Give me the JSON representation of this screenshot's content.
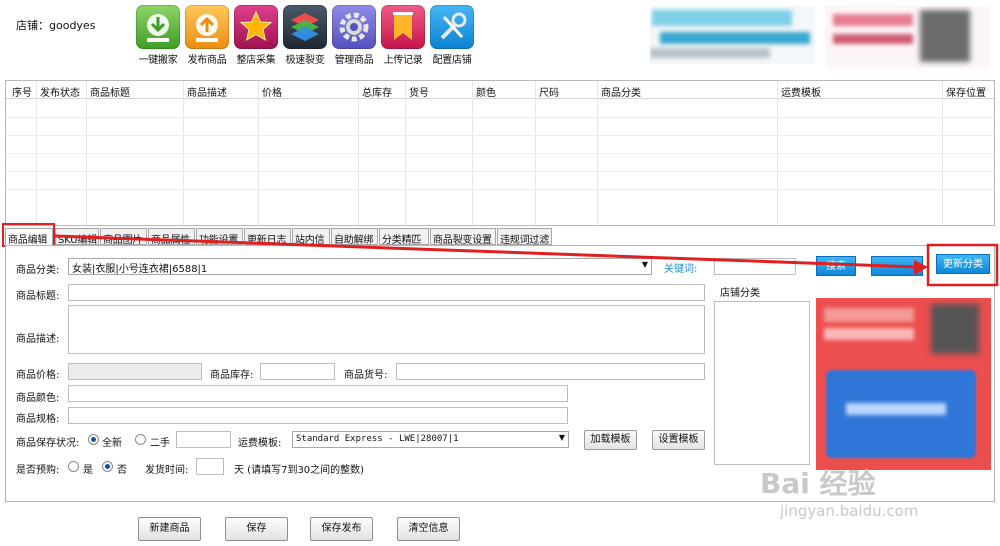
{
  "store": {
    "label": "店铺：goodyes"
  },
  "toolbar": [
    {
      "label": "一键搬家",
      "icon": "download-arrow-icon",
      "color": "#5cb83a"
    },
    {
      "label": "发布商品",
      "icon": "upload-arrow-icon",
      "color": "#f2a21a"
    },
    {
      "label": "整店采集",
      "icon": "star-icon",
      "color": "#c2186b"
    },
    {
      "label": "极速裂变",
      "icon": "layers-icon",
      "color": "#2f3a46"
    },
    {
      "label": "管理商品",
      "icon": "gear-icon",
      "color": "#6e6ad8"
    },
    {
      "label": "上传记录",
      "icon": "bookmark-icon",
      "color": "#e02c62"
    },
    {
      "label": "配置店铺",
      "icon": "tools-icon",
      "color": "#1196e3"
    }
  ],
  "grid": {
    "columns": [
      "序号",
      "发布状态",
      "商品标题",
      "商品描述",
      "价格",
      "总库存",
      "货号",
      "颜色",
      "尺码",
      "商品分类",
      "运费模板",
      "保存位置"
    ]
  },
  "tabs": [
    "商品编辑",
    "SKU编辑",
    "商品图片",
    "商品属性",
    "功能设置",
    "更新日志",
    "站内信",
    "自助解绑",
    "分类精匹",
    "商品裂变设置",
    "违规词过滤"
  ],
  "form": {
    "category_label": "商品分类:",
    "category_value": "女装|衣服|小号连衣裙|6588|1",
    "keyword_label": "关键词:",
    "search_btn": "搜索",
    "update_category_btn": "更新分类",
    "store_category_label": "店铺分类",
    "title_label": "商品标题:",
    "desc_label": "商品描述:",
    "price_label": "商品价格:",
    "stock_label": "商品库存:",
    "code_label": "商品货号:",
    "color_label": "商品颜色:",
    "spec_label": "商品规格:",
    "condition_label": "商品保存状况:",
    "condition_new": "全新",
    "condition_used": "二手",
    "shipping_label": "运费模板:",
    "shipping_value": "Standard Express - LWE|28007|1",
    "load_template_btn": "加载模板",
    "set_template_btn": "设置模板",
    "presale_label": "是否预购:",
    "presale_yes": "是",
    "presale_no": "否",
    "ship_time_label": "发货时间:",
    "ship_time_hint": "天 (请填写7到30之间的整数)"
  },
  "bottom": [
    "新建商品",
    "保存",
    "保存发布",
    "清空信息"
  ],
  "watermark": {
    "brand": "Bai 经验",
    "url": "jingyan.baidu.com"
  },
  "colors": {
    "highlight": "#e02020",
    "accent_blue": "#1a8ee0"
  }
}
